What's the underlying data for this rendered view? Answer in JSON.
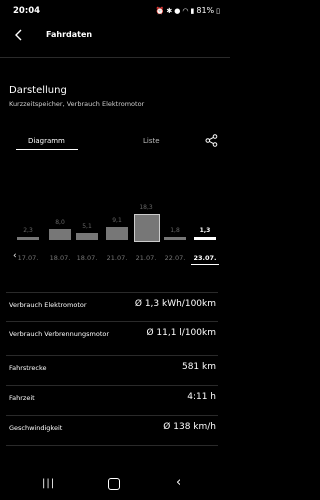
{
  "status_bar": {
    "time": "20:04",
    "battery": "81%"
  },
  "header": {
    "title": "Fahrdaten"
  },
  "section": {
    "title": "Darstellung",
    "subtitle": "Kurzzeitspeicher, Verbrauch Elektromotor"
  },
  "tabs": [
    {
      "label": "Diagramm",
      "active": true
    },
    {
      "label": "Liste",
      "active": false
    }
  ],
  "chart_data": {
    "type": "bar",
    "categories": [
      "17.07.",
      "18.07.",
      "18.07.",
      "21.07.",
      "21.07.",
      "22.07.",
      "23.07."
    ],
    "values": [
      2.3,
      8.0,
      5.1,
      9.1,
      18.3,
      1.8,
      1.3
    ],
    "value_labels": [
      "2,3",
      "8,0",
      "5,1",
      "9,1",
      "18,3",
      "1,8",
      "1,3"
    ],
    "selected_index": 6,
    "colors": {
      "bar": "#777777",
      "selected": "#ffffff"
    }
  },
  "rows": [
    {
      "label": "Verbrauch Elektromotor",
      "value": "Ø 1,3 kWh/100km"
    },
    {
      "label": "Verbrauch Verbrennungsmotor",
      "value": "Ø 11,1 l/100km"
    },
    {
      "label": "Fahrstrecke",
      "value": "581 km"
    },
    {
      "label": "Fahrzeit",
      "value": "4:11 h"
    },
    {
      "label": "Geschwindigkeit",
      "value": "Ø 138 km/h"
    }
  ]
}
